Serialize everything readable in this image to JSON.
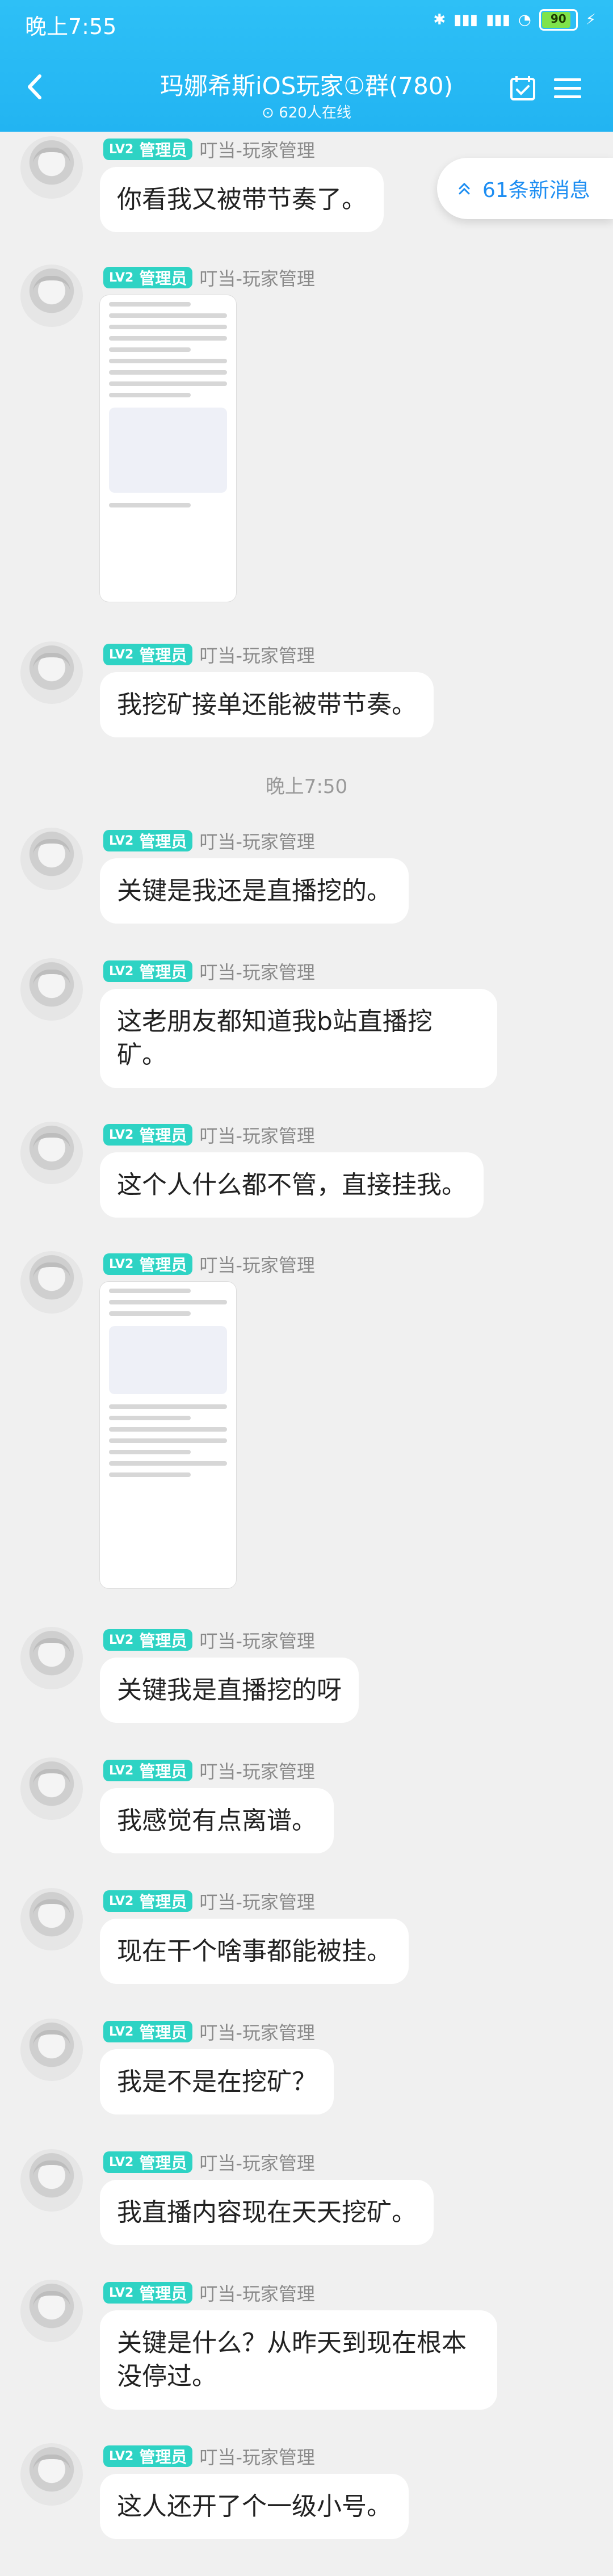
{
  "status": {
    "time": "晚上7:55",
    "battery": "90"
  },
  "header": {
    "title": "玛娜希斯iOS玩家①群(780)",
    "online": "620人在线"
  },
  "new_messages": "61条新消息",
  "messages": [
    {
      "type": "text",
      "badge_level": "LV2",
      "badge": "管理员",
      "name": "叮当-玩家管理",
      "text": "你看我又被带节奏了。"
    },
    {
      "type": "image",
      "badge_level": "LV2",
      "badge": "管理员",
      "name": "叮当-玩家管理"
    },
    {
      "type": "text",
      "badge_level": "LV2",
      "badge": "管理员",
      "name": "叮当-玩家管理",
      "text": "我挖矿接单还能被带节奏。"
    },
    {
      "type": "time",
      "text": "晚上7:50"
    },
    {
      "type": "text",
      "badge_level": "LV2",
      "badge": "管理员",
      "name": "叮当-玩家管理",
      "text": "关键是我还是直播挖的。"
    },
    {
      "type": "text",
      "badge_level": "LV2",
      "badge": "管理员",
      "name": "叮当-玩家管理",
      "text": "这老朋友都知道我b站直播挖矿。"
    },
    {
      "type": "text",
      "badge_level": "LV2",
      "badge": "管理员",
      "name": "叮当-玩家管理",
      "text": "这个人什么都不管，直接挂我。"
    },
    {
      "type": "image",
      "badge_level": "LV2",
      "badge": "管理员",
      "name": "叮当-玩家管理"
    },
    {
      "type": "text",
      "badge_level": "LV2",
      "badge": "管理员",
      "name": "叮当-玩家管理",
      "text": "关键我是直播挖的呀"
    },
    {
      "type": "text",
      "badge_level": "LV2",
      "badge": "管理员",
      "name": "叮当-玩家管理",
      "text": "我感觉有点离谱。"
    },
    {
      "type": "text",
      "badge_level": "LV2",
      "badge": "管理员",
      "name": "叮当-玩家管理",
      "text": "现在干个啥事都能被挂。"
    },
    {
      "type": "text",
      "badge_level": "LV2",
      "badge": "管理员",
      "name": "叮当-玩家管理",
      "text": "我是不是在挖矿？"
    },
    {
      "type": "text",
      "badge_level": "LV2",
      "badge": "管理员",
      "name": "叮当-玩家管理",
      "text": "我直播内容现在天天挖矿。"
    },
    {
      "type": "text",
      "badge_level": "LV2",
      "badge": "管理员",
      "name": "叮当-玩家管理",
      "text": "关键是什么？从昨天到现在根本没停过。"
    },
    {
      "type": "text",
      "badge_level": "LV2",
      "badge": "管理员",
      "name": "叮当-玩家管理",
      "text": "这人还开了个一级小号。"
    }
  ]
}
